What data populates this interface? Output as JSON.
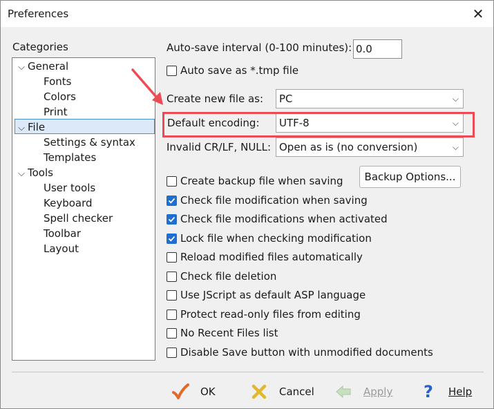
{
  "window": {
    "title": "Preferences",
    "close_glyph": "✕"
  },
  "categories": {
    "label": "Categories",
    "items": [
      {
        "label": "General",
        "expandable": true,
        "expanded": true
      },
      {
        "label": "Fonts"
      },
      {
        "label": "Colors"
      },
      {
        "label": "Print"
      },
      {
        "label": "File",
        "expandable": true,
        "expanded": true,
        "selected": true
      },
      {
        "label": "Settings & syntax"
      },
      {
        "label": "Templates"
      },
      {
        "label": "Tools",
        "expandable": true,
        "expanded": true
      },
      {
        "label": "User tools"
      },
      {
        "label": "Keyboard"
      },
      {
        "label": "Spell checker"
      },
      {
        "label": "Toolbar"
      },
      {
        "label": "Layout"
      }
    ]
  },
  "file": {
    "autosave_label": "Auto-save interval (0-100 minutes):",
    "autosave_value": "0.0",
    "autosave_tmp": {
      "label": "Auto save as *.tmp file",
      "checked": false
    },
    "create_new_label": "Create new file as:",
    "create_new_value": "PC",
    "encoding_label": "Default encoding:",
    "encoding_value": "UTF-8",
    "invalid_label": "Invalid CR/LF, NULL:",
    "invalid_value": "Open as is (no conversion)",
    "backup_button": "Backup Options...",
    "checkboxes": [
      {
        "label": "Create backup file when saving",
        "checked": false
      },
      {
        "label": "Check file modification when saving",
        "checked": true
      },
      {
        "label": "Check file modifications when activated",
        "checked": true
      },
      {
        "label": "Lock file when checking modification",
        "checked": true
      },
      {
        "label": "Reload modified files automatically",
        "checked": false
      },
      {
        "label": "Check file deletion",
        "checked": false
      },
      {
        "label": "Use JScript as default ASP language",
        "checked": false
      },
      {
        "label": "Protect read-only files from editing",
        "checked": false
      },
      {
        "label": "No Recent Files list",
        "checked": false
      },
      {
        "label": "Disable Save button with unmodified documents",
        "checked": false
      }
    ]
  },
  "buttons": {
    "ok": "OK",
    "cancel": "Cancel",
    "apply": "Apply",
    "help": "Help"
  },
  "colors": {
    "highlight": "#ec4a55",
    "checkbox_on": "#1f6fd1",
    "selection": "#dbe9f8"
  }
}
